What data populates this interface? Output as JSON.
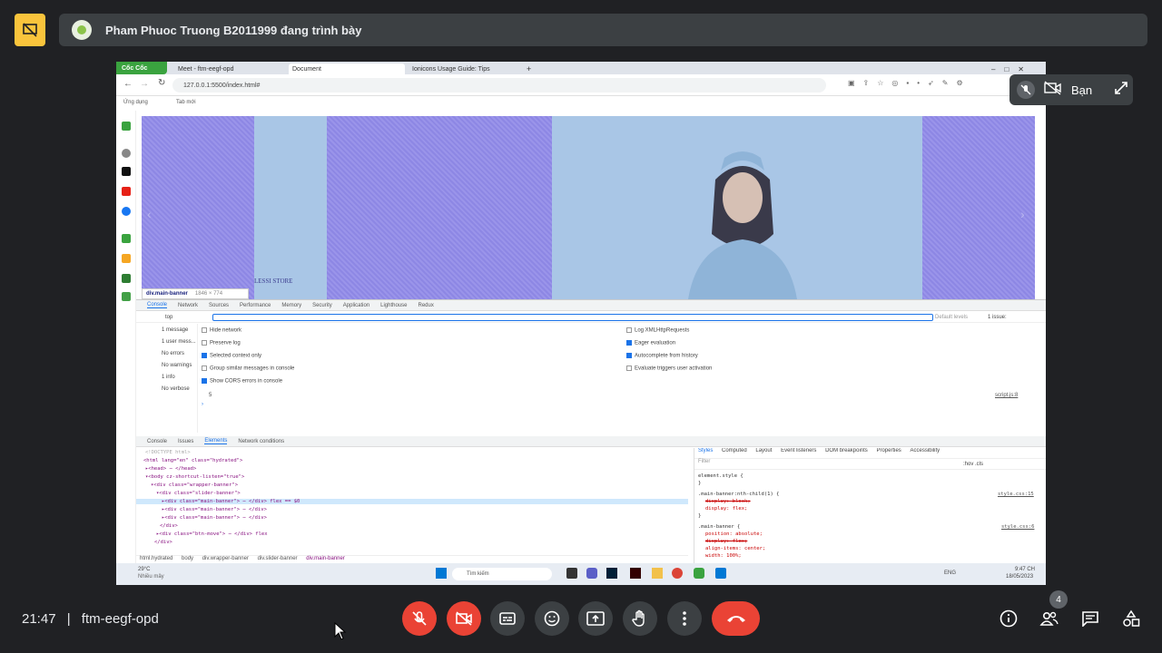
{
  "presenter": {
    "text": "Pham Phuoc Truong B2011999 đang trình bày"
  },
  "browser": {
    "brand": "Cốc Cốc",
    "tabs": [
      "Meet - ftm-eegf-opd",
      "Document",
      "Ionicons Usage Guide: Tips"
    ],
    "url": "127.0.0.1:5500/index.html#",
    "bookmarks": [
      "Ứng dụng",
      "Tab mới"
    ]
  },
  "page": {
    "banner_text": "LESSI STORE"
  },
  "devtools": {
    "tooltip_tag": "div.main-banner",
    "tooltip_size": "1846 × 774",
    "top_tabs": [
      "Console",
      "Network",
      "Sources",
      "Performance",
      "Memory",
      "Security",
      "Application",
      "Lighthouse",
      "Redux"
    ],
    "context": "top",
    "default_levels": "Default levels",
    "issues": "1 issue:",
    "summary": [
      "1 message",
      "1 user mess...",
      "No errors",
      "No warnings",
      "1 info",
      "No verbose"
    ],
    "options_left": [
      {
        "label": "Hide network",
        "on": false
      },
      {
        "label": "Preserve log",
        "on": false
      },
      {
        "label": "Selected context only",
        "on": true
      },
      {
        "label": "Group similar messages in console",
        "on": false
      },
      {
        "label": "Show CORS errors in console",
        "on": true
      }
    ],
    "options_right": [
      {
        "label": "Log XMLHttpRequests",
        "on": false
      },
      {
        "label": "Eager evaluation",
        "on": true
      },
      {
        "label": "Autocomplete from history",
        "on": true
      },
      {
        "label": "Evaluate triggers user activation",
        "on": false
      }
    ],
    "console_value": "5",
    "script_ref": "script.js:8",
    "drawer_tabs": [
      "Console",
      "Issues",
      "Elements",
      "Network conditions"
    ],
    "elements_lines": [
      "<!DOCTYPE html>",
      "<html lang=\"en\" class=\"hydrated\">",
      "▸<head> ⋯ </head>",
      "▾<body cz-shortcut-listen=\"true\">",
      "▾<div class=\"wrapper-banner\">",
      "▾<div class=\"slider-banner\">",
      "▸<div class=\"main-banner\"> ⋯ </div> flex == $0",
      "▸<div class=\"main-banner\"> ⋯ </div>",
      "▸<div class=\"main-banner\"> ⋯ </div>",
      "</div>",
      "▸<div class=\"btn-move\"> ⋯ </div> flex",
      "</div>"
    ],
    "breadcrumb": [
      "html.hydrated",
      "body",
      "div.wrapper-banner",
      "div.slider-banner",
      "div.main-banner"
    ],
    "styles_tabs": [
      "Styles",
      "Computed",
      "Layout",
      "Event listeners",
      "DOM breakpoints",
      "Properties",
      "Accessibility"
    ],
    "filter_placeholder": "Filter",
    "hov_cls": ":hov .cls",
    "style_rules": [
      "element.style {",
      "}",
      ".main-banner:nth-child(1) {",
      "display: block;",
      "display: flex;",
      "}",
      ".main-banner {",
      "position: absolute;",
      "display: flex;",
      "align-items: center;",
      "width: 100%;"
    ],
    "style_files": [
      "style.css:15",
      "style.css:6"
    ]
  },
  "taskbar": {
    "weather_temp": "29°C",
    "weather_desc": "Nhiều mây",
    "search": "Tìm kiếm",
    "lang": "ENG",
    "time": "9:47 CH",
    "date": "18/05/2023"
  },
  "selfview": {
    "name": "Bạn"
  },
  "meeting": {
    "time": "21:47",
    "separator": "|",
    "code": "ftm-eegf-opd",
    "participants": "4"
  }
}
